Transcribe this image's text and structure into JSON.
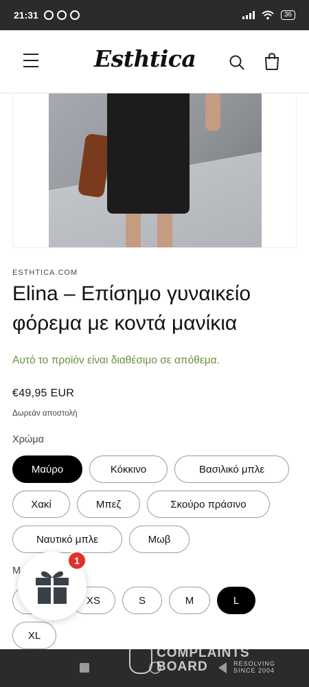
{
  "status_bar": {
    "time": "21:31",
    "battery": "36"
  },
  "header": {
    "logo": "Esthtica"
  },
  "product": {
    "vendor": "ESTHTICA.COM",
    "title": "Elina – Επίσημο γυναικείο φόρεμα με κοντά μανίκια",
    "stock_status": "Αυτό το προϊόν είναι διαθέσιμο σε απόθεμα.",
    "price": "€49,95 EUR",
    "shipping": "Δωρεάν αποστολή",
    "color_label": "Χρώμα",
    "colors": [
      {
        "label": "Μαύρο",
        "selected": true
      },
      {
        "label": "Κόκκινο",
        "selected": false
      },
      {
        "label": "Βασιλικό μπλε",
        "selected": false
      },
      {
        "label": "Χακί",
        "selected": false
      },
      {
        "label": "Μπεζ",
        "selected": false
      },
      {
        "label": "Σκούρο πράσινο",
        "selected": false
      },
      {
        "label": "Ναυτικό μπλε",
        "selected": false
      },
      {
        "label": "Μωβ",
        "selected": false
      }
    ],
    "size_label": "Μ",
    "sizes": [
      {
        "label": "S",
        "selected": false
      },
      {
        "label": "XS",
        "selected": false
      },
      {
        "label": "S",
        "selected": false
      },
      {
        "label": "M",
        "selected": false
      },
      {
        "label": "L",
        "selected": true
      },
      {
        "label": "XL",
        "selected": false
      }
    ]
  },
  "gift_widget": {
    "badge_count": "1"
  },
  "watermark": {
    "line1": "COMPLAINTS",
    "line2": "BOARD",
    "tag1": "RESOLVING",
    "tag2": "SINCE 2004"
  },
  "colors": {
    "stock_green": "#6b8e3b",
    "selected_pill": "#000000",
    "badge_red": "#e0312e"
  }
}
